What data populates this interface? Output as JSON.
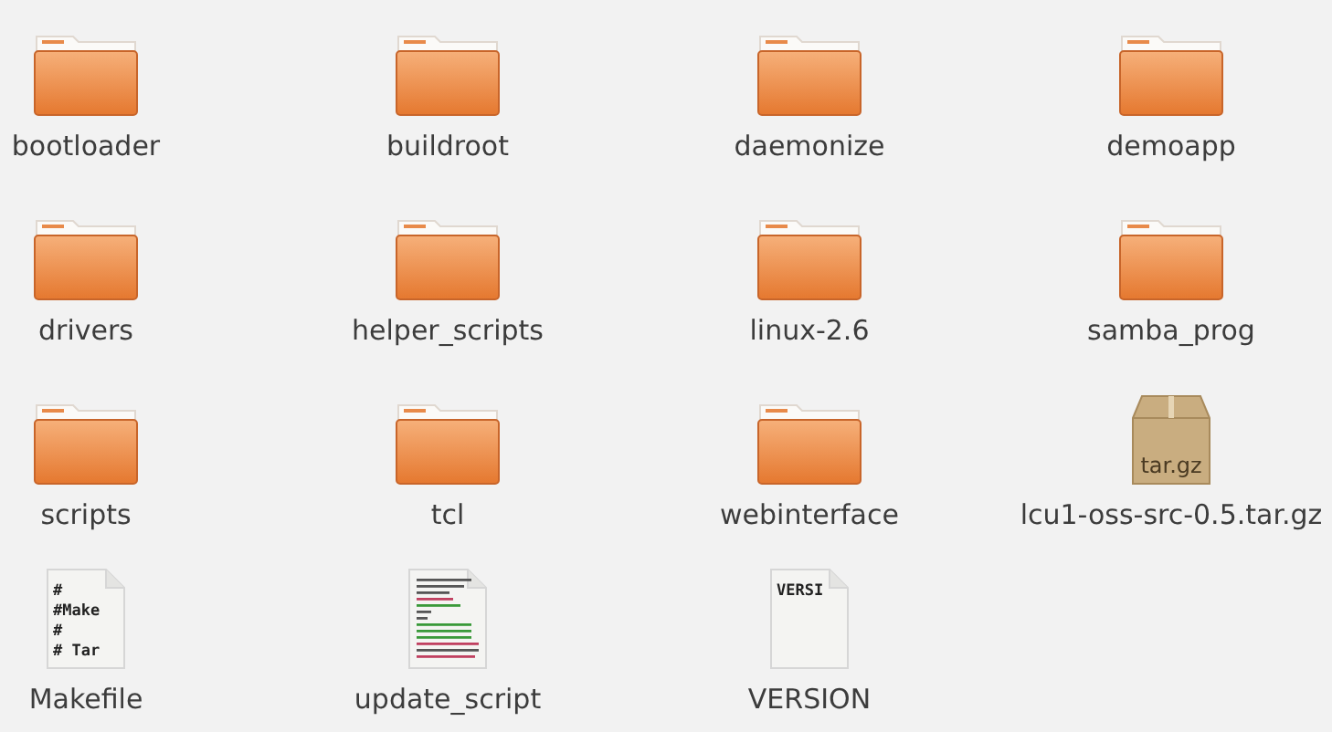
{
  "files": [
    {
      "name": "bootloader",
      "kind": "folder"
    },
    {
      "name": "buildroot",
      "kind": "folder"
    },
    {
      "name": "daemonize",
      "kind": "folder"
    },
    {
      "name": "demoapp",
      "kind": "folder"
    },
    {
      "name": "drivers",
      "kind": "folder"
    },
    {
      "name": "helper_scripts",
      "kind": "folder"
    },
    {
      "name": "linux-2.6",
      "kind": "folder"
    },
    {
      "name": "samba_prog",
      "kind": "folder"
    },
    {
      "name": "scripts",
      "kind": "folder"
    },
    {
      "name": "tcl",
      "kind": "folder"
    },
    {
      "name": "webinterface",
      "kind": "folder"
    },
    {
      "name": "lcu1-oss-src-0.5.tar.gz",
      "kind": "archive",
      "badge": "tar.gz"
    },
    {
      "name": "Makefile",
      "kind": "text",
      "preview": [
        "#",
        "#Make",
        "#",
        "# Tar"
      ]
    },
    {
      "name": "update_script",
      "kind": "document"
    },
    {
      "name": "VERSION",
      "kind": "text",
      "preview": [
        "VERSI"
      ]
    }
  ]
}
